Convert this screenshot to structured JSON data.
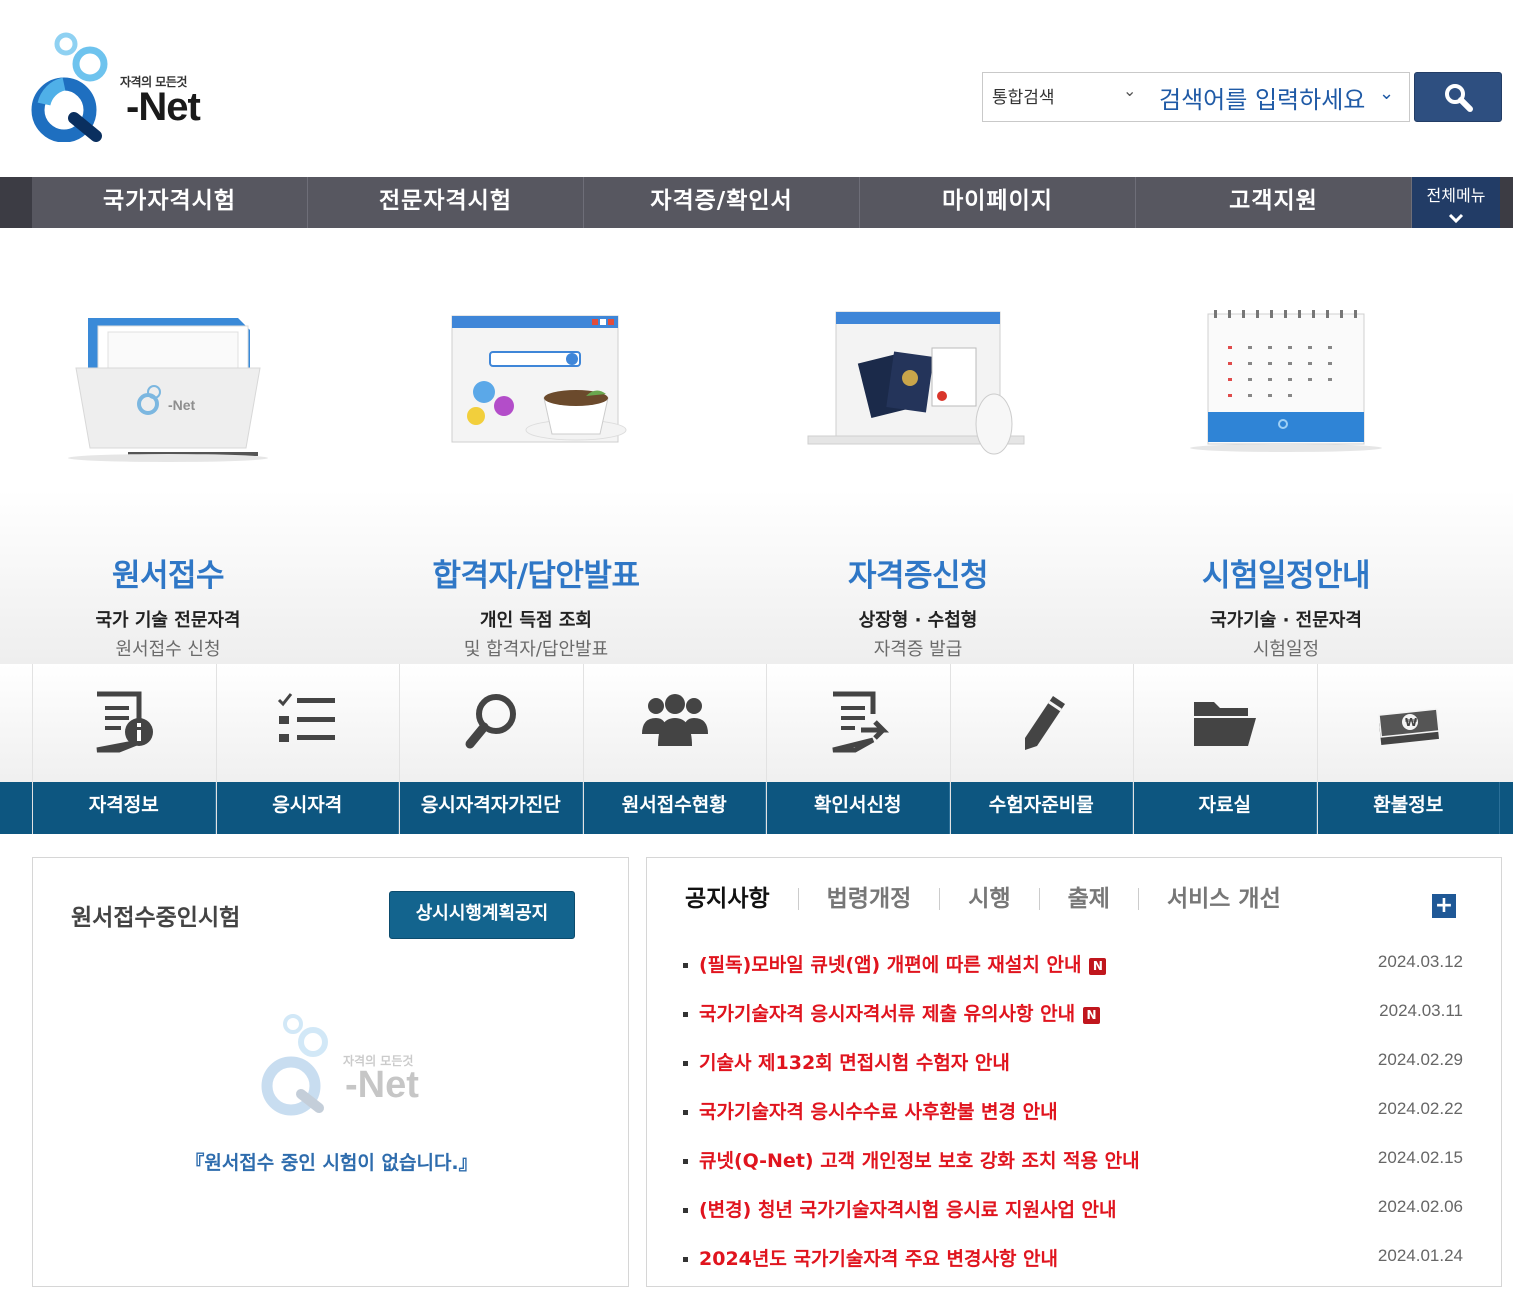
{
  "header": {
    "logo_tagline": "자격의 모든것",
    "logo_text": "Q-Net",
    "search_scope": "통합검색",
    "search_placeholder": "검색어를 입력하세요",
    "search_button_icon": "search-icon"
  },
  "gnb": {
    "items": [
      "국가자격시험",
      "전문자격시험",
      "자격증/확인서",
      "마이페이지",
      "고객지원"
    ],
    "all_menu_label": "전체메뉴"
  },
  "visual_cards": [
    {
      "title": "원서접수",
      "line1": "국가 기술 전문자격",
      "line2": "원서접수 신청",
      "icon": "folder-illustration"
    },
    {
      "title": "합격자/답안발표",
      "line1": "개인 득점 조회",
      "line2": "및 합격자/답안발표",
      "icon": "browser-coffee-illustration"
    },
    {
      "title": "자격증신청",
      "line1": "상장형 · 수첩형",
      "line2": "자격증 발급",
      "icon": "laptop-certificate-illustration"
    },
    {
      "title": "시험일정안내",
      "line1": "국가기술 · 전문자격",
      "line2": "시험일정",
      "icon": "calendar-illustration"
    }
  ],
  "quick_menu": [
    {
      "label": "자격정보",
      "icon": "document-info-icon"
    },
    {
      "label": "응시자격",
      "icon": "checklist-icon"
    },
    {
      "label": "응시자격자가진단",
      "icon": "magnifier-icon"
    },
    {
      "label": "원서접수현황",
      "icon": "people-group-icon"
    },
    {
      "label": "확인서신청",
      "icon": "document-arrow-icon"
    },
    {
      "label": "수험자준비물",
      "icon": "pencil-icon"
    },
    {
      "label": "자료실",
      "icon": "folder-icon"
    },
    {
      "label": "환불정보",
      "icon": "money-stack-icon"
    }
  ],
  "left_panel": {
    "title": "원서접수중인시험",
    "button_label": "상시시행계획공지",
    "empty_message": "『원서접수 중인 시험이 없습니다.』",
    "watermark_tagline": "자격의 모든것",
    "watermark_text": "Q-Net"
  },
  "right_panel": {
    "tabs": [
      "공지사항",
      "법령개정",
      "시행",
      "출제",
      "서비스 개선"
    ],
    "more_label": "+",
    "notices": [
      {
        "title": "(필독)모바일 큐넷(앱) 개편에 따른 재설치 안내",
        "date": "2024.03.12",
        "new": "N"
      },
      {
        "title": "국가기술자격 응시자격서류 제출 유의사항 안내",
        "date": "2024.03.11",
        "new": "N"
      },
      {
        "title": "기술사 제132회 면접시험 수험자 안내",
        "date": "2024.02.29",
        "new": ""
      },
      {
        "title": "국가기술자격 응시수수료 사후환불 변경 안내",
        "date": "2024.02.22",
        "new": ""
      },
      {
        "title": "큐넷(Q-Net) 고객 개인정보 보호 강화 조치 적용 안내",
        "date": "2024.02.15",
        "new": ""
      },
      {
        "title": "(변경) 청년 국가기술자격시험 응시료 지원사업 안내",
        "date": "2024.02.06",
        "new": ""
      },
      {
        "title": "2024년도 국가기술자격 주요 변경사항 안내",
        "date": "2024.01.24",
        "new": ""
      }
    ]
  },
  "colors": {
    "brand_blue": "#2f77c6",
    "gnb_bg": "#575760",
    "quick_band": "#0d5680",
    "notice_red": "#e0141e"
  }
}
